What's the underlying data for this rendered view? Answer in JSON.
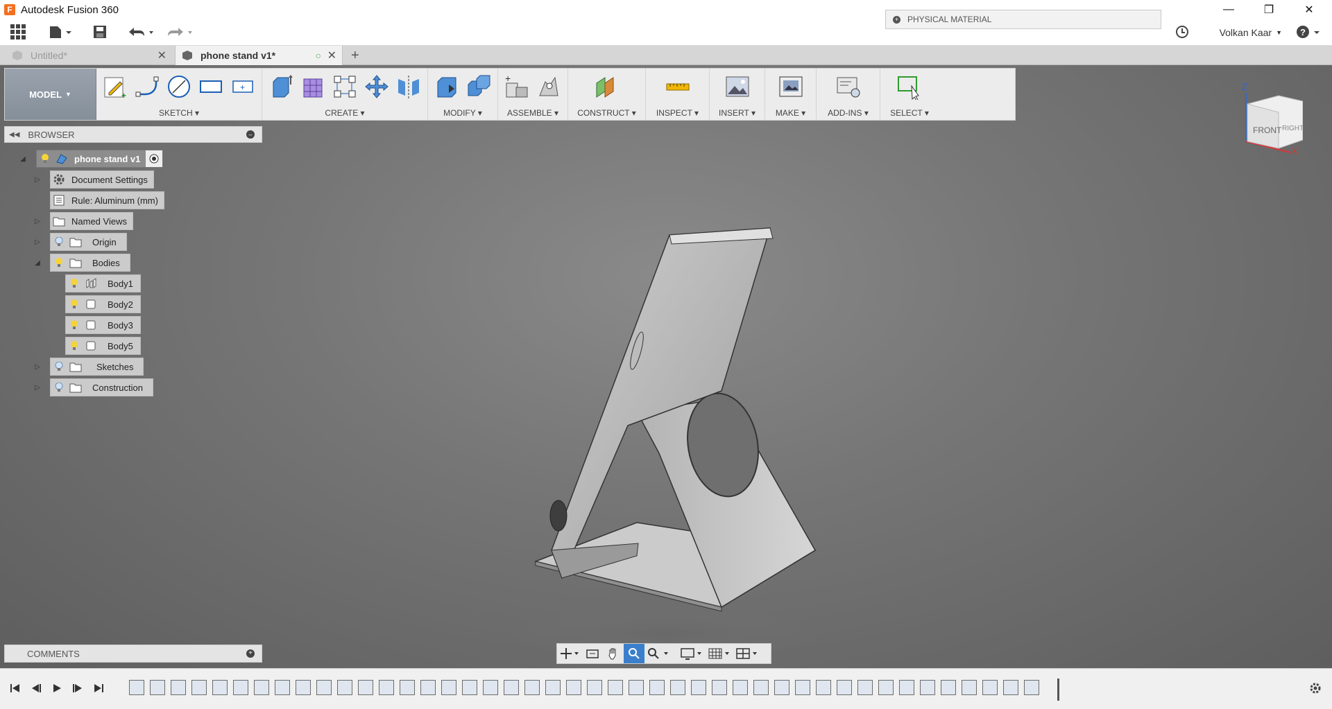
{
  "app": {
    "title": "Autodesk Fusion 360",
    "logo_letter": "F"
  },
  "physical_material": {
    "label": "PHYSICAL MATERIAL"
  },
  "user": {
    "name": "Volkan Kaar"
  },
  "tabs": [
    {
      "label": "Untitled*",
      "active": false
    },
    {
      "label": "phone stand v1*",
      "active": true
    }
  ],
  "ribbon": {
    "workspace": "MODEL",
    "groups": [
      {
        "label": "SKETCH",
        "icons": [
          "create-sketch-icon",
          "line-icon",
          "circle-icon",
          "rectangle-icon",
          "stop-sketch-icon"
        ]
      },
      {
        "label": "CREATE",
        "icons": [
          "extrude-icon",
          "form-icon",
          "pattern-icon",
          "move-body-icon",
          "mirror-icon"
        ]
      },
      {
        "label": "MODIFY",
        "icons": [
          "press-pull-icon",
          "combine-icon"
        ]
      },
      {
        "label": "ASSEMBLE",
        "icons": [
          "new-component-icon",
          "joint-icon"
        ]
      },
      {
        "label": "CONSTRUCT",
        "icons": [
          "offset-plane-icon"
        ]
      },
      {
        "label": "INSPECT",
        "icons": [
          "measure-icon"
        ]
      },
      {
        "label": "INSERT",
        "icons": [
          "insert-image-icon"
        ]
      },
      {
        "label": "MAKE",
        "icons": [
          "make-3dprint-icon"
        ]
      },
      {
        "label": "ADD-INS",
        "icons": [
          "scripts-icon"
        ]
      },
      {
        "label": "SELECT",
        "icons": [
          "select-icon"
        ]
      }
    ]
  },
  "browser": {
    "title": "BROWSER",
    "root": "phone stand v1",
    "items": [
      {
        "label": "Document Settings"
      },
      {
        "label": "Rule: Aluminum (mm)"
      },
      {
        "label": "Named Views"
      },
      {
        "label": "Origin"
      },
      {
        "label": "Bodies"
      },
      {
        "label": "Body1"
      },
      {
        "label": "Body2"
      },
      {
        "label": "Body3"
      },
      {
        "label": "Body5"
      },
      {
        "label": "Sketches"
      },
      {
        "label": "Construction"
      }
    ]
  },
  "comments": {
    "title": "COMMENTS"
  },
  "viewcube": {
    "front": "FRONT",
    "right": "RIGHT",
    "axis_z": "Z",
    "axis_x": "X"
  },
  "colors": {
    "accent": "#1a79c2",
    "workspace_bg": "#8d96a0",
    "bulb": "#f5d33b"
  }
}
